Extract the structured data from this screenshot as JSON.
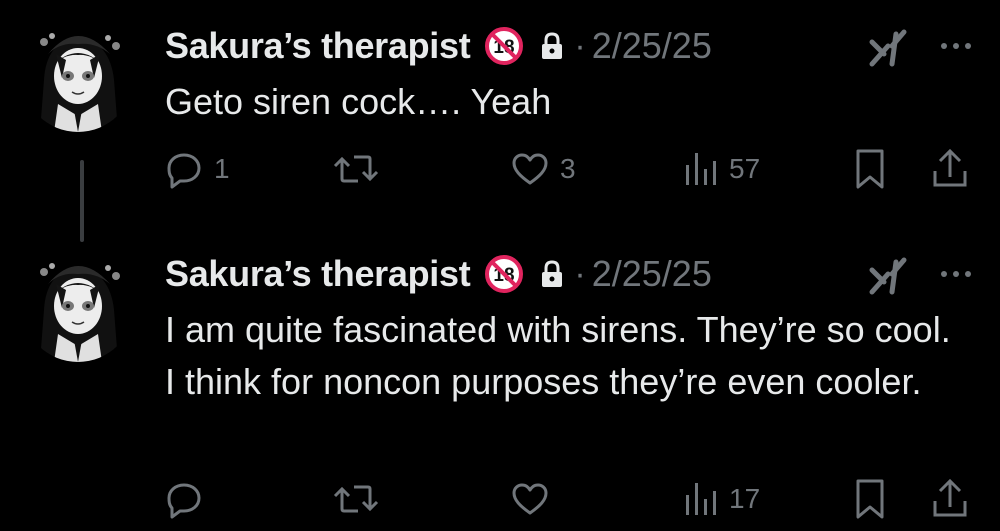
{
  "tweets": [
    {
      "display_name": "Sakura’s therapist",
      "dot": "·",
      "date": "2/25/25",
      "text": "Geto siren cock…. Yeah",
      "reply_count": "1",
      "retweet_count": "",
      "like_count": "3",
      "view_count": "57"
    },
    {
      "display_name": "Sakura’s therapist",
      "dot": "·",
      "date": "2/25/25",
      "text": "I am quite fascinated with sirens. They’re so cool. I think for noncon purposes they’re even cooler.",
      "reply_count": "",
      "retweet_count": "",
      "like_count": "",
      "view_count": "17"
    }
  ],
  "badge_text": "18",
  "icons": [
    "avatar",
    "eighteen-badge-icon",
    "lock-icon",
    "grok-icon",
    "more-icon",
    "reply-icon",
    "retweet-icon",
    "like-icon",
    "views-icon",
    "bookmark-icon",
    "share-icon"
  ],
  "colors": {
    "background": "#000000",
    "text": "#e7e9ea",
    "muted": "#71767b",
    "badge_red": "#e0245e",
    "thread_line": "#3a3d40"
  }
}
